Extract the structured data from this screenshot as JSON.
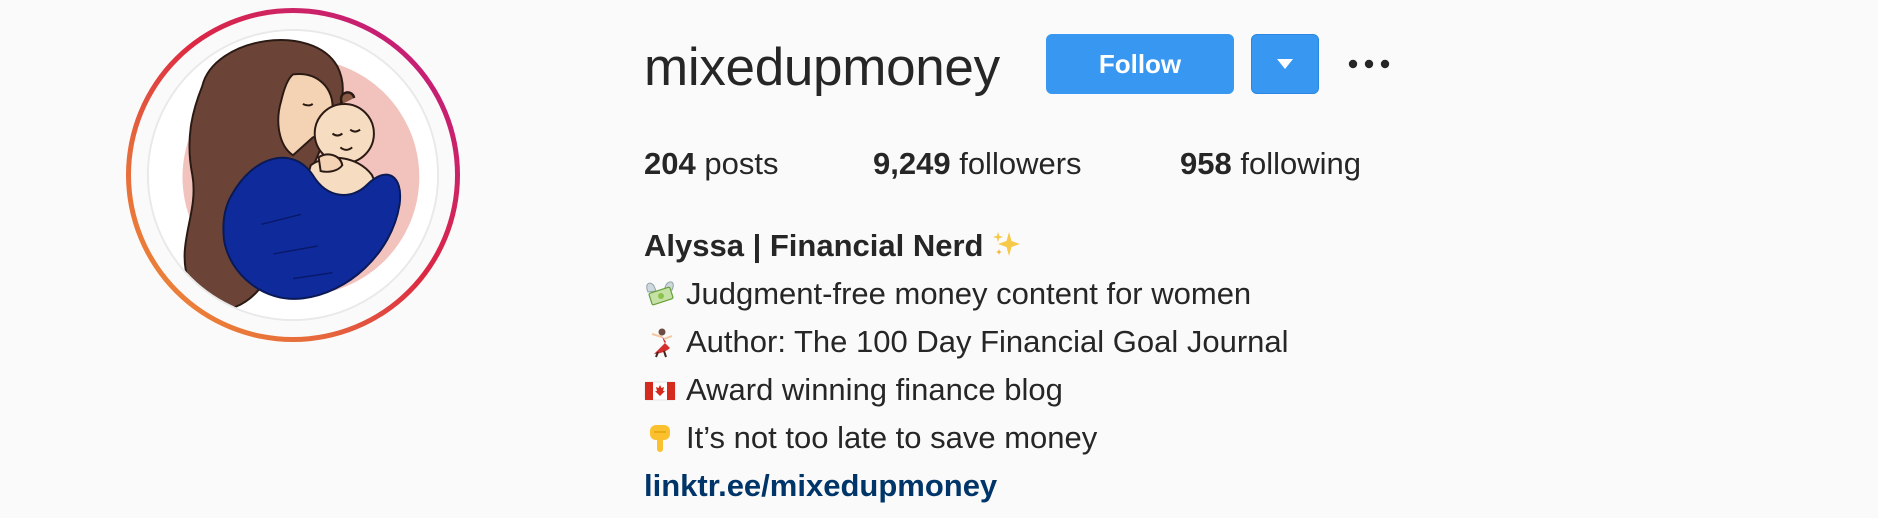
{
  "profile": {
    "username": "mixedupmoney",
    "avatar_icon": "illustrated-mother-and-baby-avatar",
    "story_ring_colors": [
      "#f09433",
      "#dc2743",
      "#bc1888"
    ]
  },
  "actions": {
    "follow_label": "Follow",
    "dropdown_icon": "caret-down-icon",
    "more_icon": "more-options-icon",
    "accent_color": "#3897f0"
  },
  "stats": {
    "posts": {
      "count": "204",
      "label": "posts"
    },
    "followers": {
      "count": "9,249",
      "label": "followers"
    },
    "following": {
      "count": "958",
      "label": "following"
    }
  },
  "bio": {
    "name": "Alyssa | Financial Nerd",
    "name_emoji": "sparkles-icon",
    "lines": [
      {
        "icon": "money-with-wings-icon",
        "text": "Judgment-free money content for women"
      },
      {
        "icon": "dancer-icon",
        "text": "Author: The 100 Day Financial Goal Journal"
      },
      {
        "icon": "canada-flag-icon",
        "text": "Award winning finance blog"
      },
      {
        "icon": "pointing-down-icon",
        "text": "It’s not too late to save money"
      }
    ],
    "link": "linktr.ee/mixedupmoney",
    "link_color": "#003569"
  }
}
